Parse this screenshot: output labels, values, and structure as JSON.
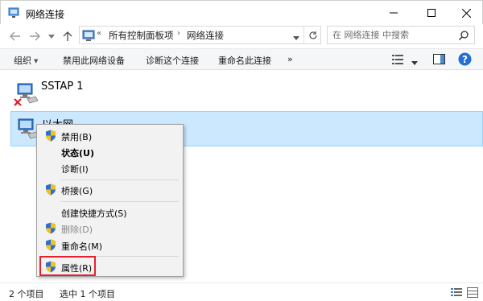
{
  "window": {
    "title": "网络连接",
    "controls": [
      "minimize-icon",
      "maximize-icon",
      "close-icon"
    ]
  },
  "address_bar": {
    "overflow": "«",
    "breadcrumbs": [
      "所有控制面板项",
      "网络连接"
    ],
    "search_placeholder": "在 网络连接 中搜索"
  },
  "toolbar": {
    "organize": "组织",
    "disable_device": "禁用此网络设备",
    "diagnose": "诊断这个连接",
    "rename": "重命名此连接",
    "more": "»"
  },
  "connections": [
    {
      "name": "SSTAP 1",
      "status": "disconnected",
      "icon": "network-adapter-icon"
    },
    {
      "name": "以太网",
      "status": "selected",
      "icon": "network-adapter-icon"
    }
  ],
  "context_menu": {
    "items": [
      {
        "label": "禁用(B)",
        "shield": true,
        "bold": false,
        "disabled": false
      },
      {
        "label": "状态(U)",
        "shield": false,
        "bold": true,
        "disabled": false
      },
      {
        "label": "诊断(I)",
        "shield": false,
        "bold": false,
        "disabled": false
      },
      {
        "label": "桥接(G)",
        "shield": true,
        "bold": false,
        "disabled": false
      },
      {
        "label": "创建快捷方式(S)",
        "shield": false,
        "bold": false,
        "disabled": false
      },
      {
        "label": "删除(D)",
        "shield": true,
        "bold": false,
        "disabled": true
      },
      {
        "label": "重命名(M)",
        "shield": true,
        "bold": false,
        "disabled": false
      },
      {
        "label": "属性(R)",
        "shield": true,
        "bold": false,
        "disabled": false,
        "highlighted": true
      }
    ]
  },
  "status_bar": {
    "item_count": "2 个项目",
    "selected_count": "选中 1 个项目"
  },
  "colors": {
    "selection_bg": "#cce8ff",
    "selection_border": "#99d1ff",
    "highlight_red": "#e8202e",
    "shield_blue": "#2b6fd6",
    "shield_yellow": "#f3c21a"
  }
}
